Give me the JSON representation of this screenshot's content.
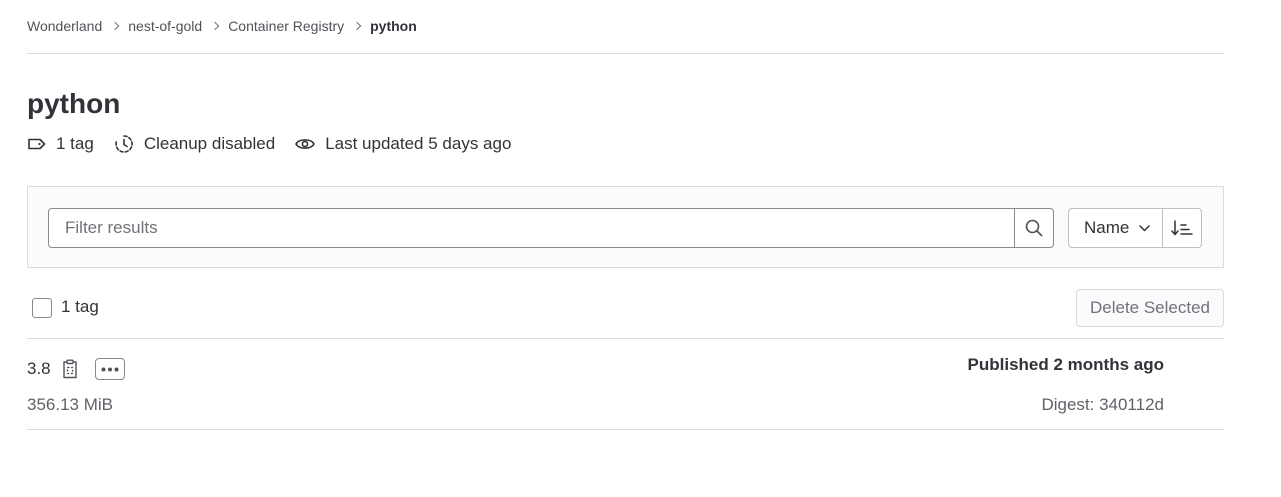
{
  "breadcrumb": {
    "items": [
      "Wonderland",
      "nest-of-gold",
      "Container Registry"
    ],
    "current": "python"
  },
  "page": {
    "title": "python"
  },
  "meta": {
    "tags": "1 tag",
    "cleanup": "Cleanup disabled",
    "updated": "Last updated 5 days ago",
    "icons": [
      "label-icon",
      "expire-clock-icon",
      "eye-icon"
    ]
  },
  "filter": {
    "placeholder": "Filter results",
    "value": ""
  },
  "sort": {
    "selected": "Name",
    "direction": "ascending"
  },
  "tags_header": {
    "count_label": "1 tag",
    "checked": false,
    "delete_label": "Delete Selected"
  },
  "tags": [
    {
      "name": "3.8",
      "size": "356.13 MiB",
      "published": "Published 2 months ago",
      "digest": "Digest: 340112d"
    }
  ],
  "colors": {
    "text": "#333238",
    "muted": "#737278",
    "border": "#dcdcde",
    "panel_bg": "#fbfafd"
  }
}
